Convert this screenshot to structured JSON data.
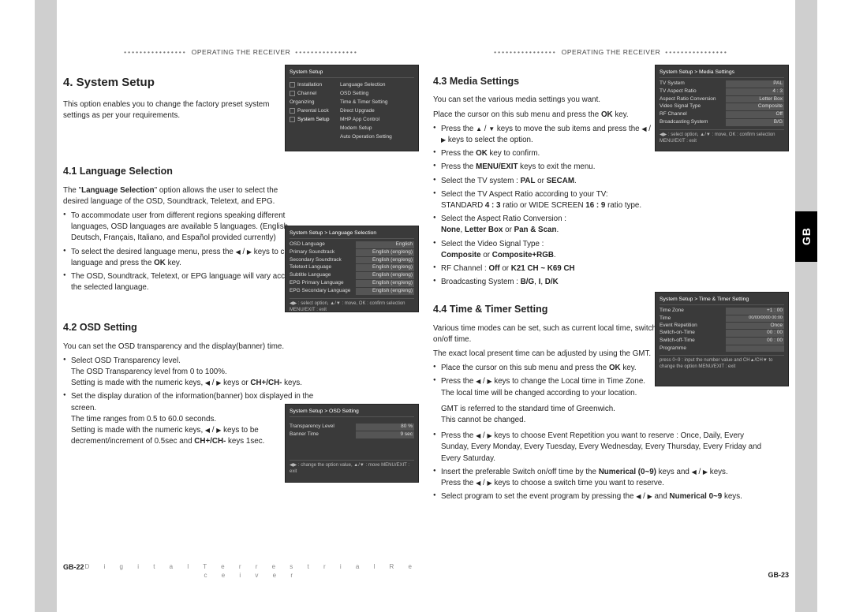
{
  "header": "OPERATING THE RECEIVER",
  "tab": "GB",
  "footerDescriptor": "D i g i t a l   T e r r e s t r i a l   R e c e i v e r",
  "left": {
    "pageNo": "GB-22",
    "h2": "4. System Setup",
    "intro": "This option enables you to change the factory preset system settings as per your requirements.",
    "s41": {
      "title": "4.1 Language Selection",
      "intro": "The \"Language Selection\" option allows the user to select the desired language of the OSD, Soundtrack, Teletext, and EPG.",
      "b1": "To accommodate user from different regions speaking different languages, OSD languages are available 5 languages. (English, Deutsch, Français, Italiano, and Español provided currently)",
      "b2": "To select the desired language menu, press the ◀ / ▶ keys to change language and press the OK key.",
      "b3": "The OSD, Soundtrack, Teletext, or EPG language will vary according to the selected language.",
      "ls": "Language Selection"
    },
    "s42": {
      "title": "4.2 OSD Setting",
      "intro": "You can set the OSD transparency and the display(banner) time.",
      "b1a": "Select OSD Transparency level.",
      "b1b": "The OSD Transparency level from 0 to 100%.",
      "b1c": "Setting is made with the numeric keys, ◀ / ▶ keys or CH+/CH- keys.",
      "b2a": "Set the display duration of the information(banner) box displayed in the screen.",
      "b2b": "The time ranges from 0.5 to 60.0 seconds.",
      "b2c": "Setting is made with the numeric keys, ◀ / ▶ keys to be decrement/increment of 0.5sec and CH+/CH- keys 1sec.",
      "chkeys": "CH+/CH-"
    },
    "shot1": {
      "title": "System Setup",
      "m1": "Installation",
      "m2": "Channel Organizing",
      "m3": "Parental Lock",
      "m4": "System Setup",
      "r1": "Language Selection",
      "r2": "OSD Setting",
      "r3": "Time & Timer Setting",
      "r4": "Direct Upgrade",
      "r5": "MHP App Control",
      "r6": "Modem Setup",
      "r7": "Auto Operation Setting"
    },
    "shot2": {
      "title": "System Setup > Language Selection",
      "l": "OSD Language",
      "v": "English",
      "r1k": "Primary Soundtrack",
      "r1v": "English (eng/eng)",
      "r2k": "Secondary Soundtrack",
      "r2v": "English (eng/eng)",
      "r3k": "Teletext Language",
      "r3v": "English (eng/eng)",
      "r4k": "Subtitle Language",
      "r4v": "English (eng/eng)",
      "r5k": "EPG Primary Language",
      "r5v": "English (eng/eng)",
      "r6k": "EPG Secondary Language",
      "r6v": "English (eng/eng)",
      "foot": "◀▶ : select option, ▲/▼ : move, OK : confirm selection  MENU/EXIT : exit"
    },
    "shot3": {
      "title": "System Setup > OSD Setting",
      "r1k": "Transparency Level",
      "r1v": "80 %",
      "r2k": "Banner Time",
      "r2v": "9 sec",
      "foot": "◀▶ : change the option value, ▲/▼ : move  MENU/EXIT : exit"
    }
  },
  "right": {
    "pageNo": "GB-23",
    "s43": {
      "title": "4.3 Media Settings",
      "p1": "You can set the various media settings you want.",
      "p2": "Place the cursor on this sub menu and press the OK key.",
      "b1": "Press the ▲ / ▼ keys  to move the sub items and press the ◀ / ▶ keys to select the option.",
      "b2": "Press the OK key to confirm.",
      "b3": "Press the MENU/EXIT keys to exit the menu.",
      "b4": "Select the TV system : PAL or SECAM.",
      "b5a": "Select the TV Aspect Ratio according to your TV:",
      "b5b": "STANDARD 4 : 3 ratio or WIDE SCREEN 16 : 9 ratio type.",
      "b6a": "Select the Aspect Ratio Conversion :",
      "b6b": "None, Letter Box or Pan & Scan.",
      "b7a": "Select the Video Signal Type :",
      "b7b": "Composite or Composite+RGB.",
      "b8": "RF Channel : Off or K21 CH ~ K69 CH",
      "b9": "Broadcasting System : B/G, I, D/K"
    },
    "s44": {
      "title": "4.4 Time & Timer Setting",
      "p1": "Various time modes can be set, such as current local time, switch on/off time.",
      "p2": "The exact local present time can be adjusted by using the GMT.",
      "b1": "Place the cursor on this sub menu and press the OK key.",
      "b2a": "Press the ◀ / ▶ keys to change the Local time in Time Zone.",
      "b2b": "The local time will be changed according to your location.",
      "gmt1": "GMT is referred to the standard time of Greenwich.",
      "gmt2": "This cannot be changed.",
      "b3": "Press the ◀ / ▶ keys to choose Event Repetition you want to reserve : Once, Daily, Every Sunday, Every Monday,  Every Tuesday, Every Wednesday, Every Thursday, Every Friday and Every Saturday.",
      "b4a": "Insert the preferable Switch on/off time by the Numerical (0~9) keys and ◀ / ▶ keys.",
      "b4b": "Press the ◀ / ▶ keys to choose a switch time you want to reserve.",
      "b5": "Select program to set the event program by pressing the ◀ / ▶ and Numerical 0~9 keys."
    },
    "shot4": {
      "title": "System Setup > Media Settings",
      "r1k": "TV System",
      "r1v": "PAL",
      "r2k": "TV Aspect Ratio",
      "r2v": "4 : 3",
      "r3k": "Aspect Ratio Conversion",
      "r3v": "Letter Box",
      "r4k": "Video Signal Type",
      "r4v": "Composite",
      "r5k": "RF Channel",
      "r5v": "Off",
      "r6k": "Broadcasting System",
      "r6v": "B/G",
      "foot": "◀▶ : select option, ▲/▼ : move, OK : confirm selection  MENU/EXIT : exit"
    },
    "shot5": {
      "title": "System Setup > Time & Timer Setting",
      "r1k": "Time Zone",
      "r1v": "+1 : 00",
      "r2k": "Time",
      "r2v": "00/00/0000  00:00",
      "r3k": "Event Repetition",
      "r3v": "Once",
      "r4k": "Switch-on-Time",
      "r4v": "00 : 00",
      "r5k": "Switch-off-Time",
      "r5v": "00 : 00",
      "r6k": "Programme",
      "r6v": "",
      "foot": "press 0~9 : input the number value and CH▲/CH▼ to change the option  MENU/EXIT : exit"
    }
  }
}
